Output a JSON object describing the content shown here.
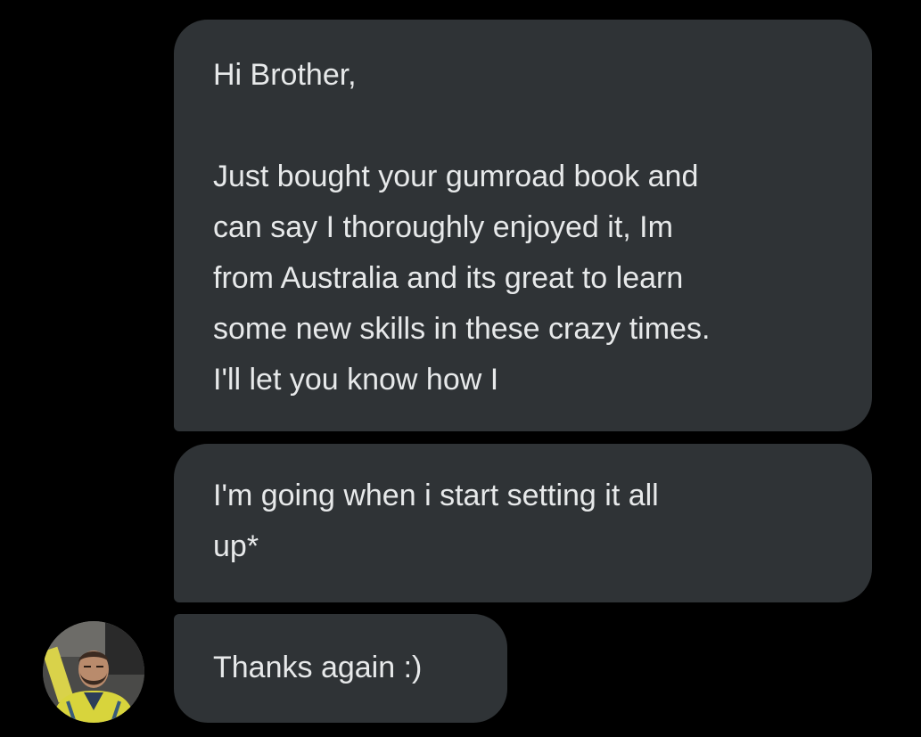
{
  "conversation": {
    "messages": [
      {
        "lines": [
          "Hi Brother,",
          "",
          "Just bought your gumroad book and",
          "can say I thoroughly enjoyed it, Im",
          "from Australia and its great to learn",
          "some new skills in these crazy times.",
          "I'll let you know how I"
        ]
      },
      {
        "lines": [
          "I'm going when i start setting it all",
          "up*"
        ]
      },
      {
        "lines": [
          "Thanks again :)"
        ]
      }
    ]
  },
  "colors": {
    "background": "#000000",
    "bubble": "#2f3336",
    "text": "#e7e9ea"
  }
}
